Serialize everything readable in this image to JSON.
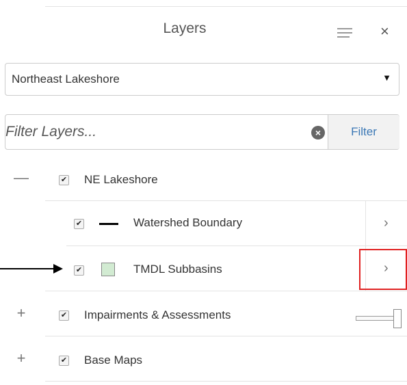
{
  "panel": {
    "title": "Layers",
    "menu_icon": "hamburger-menu-icon",
    "close_icon": "close-icon",
    "close_glyph": "×"
  },
  "project_select": {
    "value": "Northeast Lakeshore",
    "caret": "▼"
  },
  "filter": {
    "placeholder": "Filter Layers...",
    "clear_glyph": "×",
    "button_label": "Filter"
  },
  "layers": [
    {
      "name": "NE Lakeshore",
      "expander": "—",
      "checked": true,
      "check_glyph": "✔",
      "children": [
        {
          "name": "Watershed Boundary",
          "checked": true,
          "check_glyph": "✔",
          "symbol": "line",
          "symbol_color": "#000000",
          "detail_glyph": "›"
        },
        {
          "name": "TMDL Subbasins",
          "checked": true,
          "check_glyph": "✔",
          "symbol": "fill",
          "symbol_color": "#d2ebd2",
          "detail_glyph": "›"
        }
      ]
    },
    {
      "name": "Impairments & Assessments",
      "expander": "+",
      "checked": true,
      "check_glyph": "✔",
      "opacity_slider_value": 1.0
    },
    {
      "name": "Base Maps",
      "expander": "+",
      "checked": true,
      "check_glyph": "✔"
    }
  ],
  "annotations": {
    "highlight_color": "#e02020",
    "arrow_color": "#000000"
  }
}
